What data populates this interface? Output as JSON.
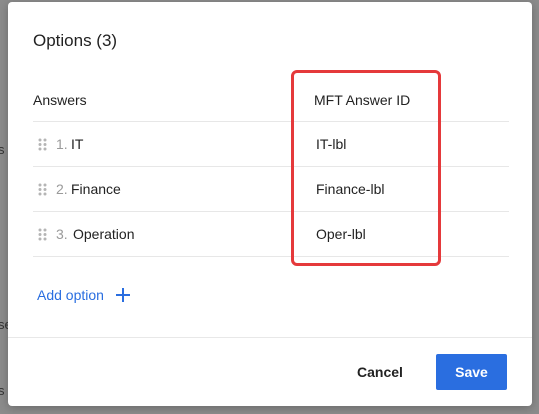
{
  "dialog": {
    "title": "Options (3)",
    "columns": {
      "answers": "Answers",
      "mft_answer_id": "MFT Answer ID"
    },
    "rows": [
      {
        "number": "1.",
        "answer": "IT",
        "mft_id": "IT-lbl"
      },
      {
        "number": "2.",
        "answer": "Finance",
        "mft_id": "Finance-lbl"
      },
      {
        "number": "3.",
        "answer": "Operation",
        "mft_id": "Oper-lbl"
      }
    ],
    "add_option_label": "Add option",
    "cancel_label": "Cancel",
    "save_label": "Save"
  },
  "background": {
    "fragments": [
      "s",
      "se",
      "s"
    ]
  },
  "icons": {
    "drag": "drag-handle-icon",
    "add": "plus-icon"
  },
  "colors": {
    "accent": "#2a6ee0",
    "highlight_border": "#e5393b",
    "overlay": "#8c8c8c"
  }
}
